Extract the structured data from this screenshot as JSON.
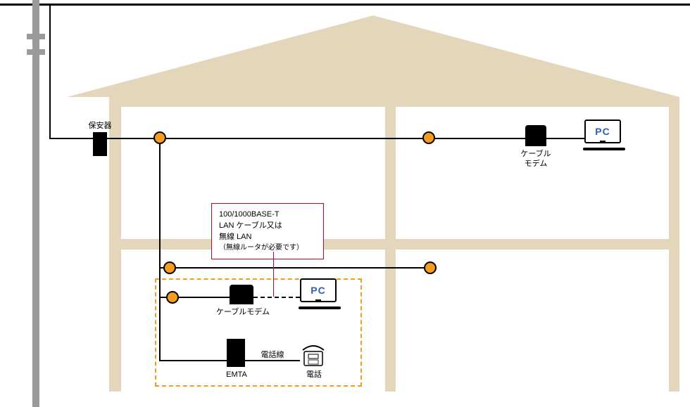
{
  "labels": {
    "safety_device": "保安器",
    "cable_modem": "ケーブル\nモデム",
    "cable_modem2": "ケーブルモデム",
    "emta": "EMTA",
    "phone_line": "電話線",
    "phone": "電話",
    "pc": "PC"
  },
  "callout": {
    "line1": "100/1000BASE-T",
    "line2": "LAN ケーブル又は",
    "line3": "無線 LAN",
    "line4": "（無線ルータが必要です）"
  }
}
